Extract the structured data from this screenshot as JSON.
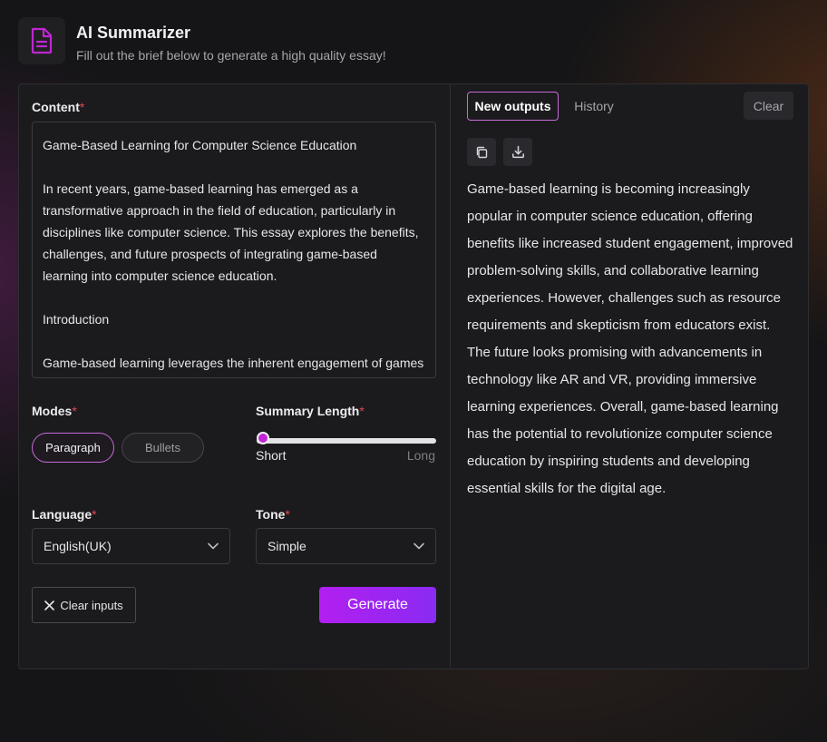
{
  "header": {
    "title": "AI Summarizer",
    "subtitle": "Fill out the brief below to generate a high quality essay!",
    "icon": "document-icon",
    "accent": "#c026d3"
  },
  "form": {
    "content": {
      "label": "Content",
      "required_mark": "*",
      "paragraphs": [
        "Game-Based Learning for Computer Science Education",
        "In recent years, game-based learning has emerged as a transformative approach in the field of education, particularly in disciplines like computer science. This essay explores the benefits, challenges, and future prospects of integrating game-based learning into computer science education.",
        "Introduction",
        "Game-based learning leverages the inherent engagement of games"
      ]
    },
    "modes": {
      "label": "Modes",
      "required_mark": "*",
      "options": [
        "Paragraph",
        "Bullets"
      ],
      "selected": "Paragraph"
    },
    "summary_length": {
      "label": "Summary Length",
      "required_mark": "*",
      "min_label": "Short",
      "max_label": "Long",
      "value_fraction": 0
    },
    "language": {
      "label": "Language",
      "required_mark": "*",
      "value": "English(UK)"
    },
    "tone": {
      "label": "Tone",
      "required_mark": "*",
      "value": "Simple"
    },
    "clear_inputs_label": "Clear inputs",
    "generate_label": "Generate"
  },
  "output": {
    "tabs": [
      "New outputs",
      "History"
    ],
    "active_tab": "New outputs",
    "clear_label": "Clear",
    "actions": [
      "copy-icon",
      "download-icon"
    ],
    "text": "Game-based learning is becoming increasingly popular in computer science education, offering benefits like increased student engagement, improved problem-solving skills, and collaborative learning experiences. However, challenges such as resource requirements and skepticism from educators exist. The future looks promising with advancements in technology like AR and VR, providing immersive learning experiences. Overall, game-based learning has the potential to revolutionize computer science education by inspiring students and developing essential skills for the digital age."
  }
}
